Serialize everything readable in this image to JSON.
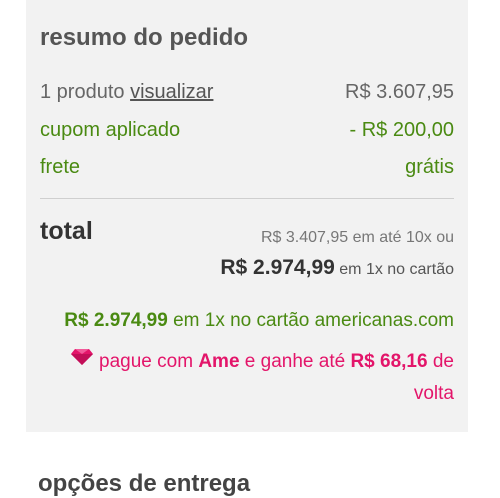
{
  "summary": {
    "title": "resumo do pedido",
    "products_prefix": "1 produto",
    "view_link": "visualizar",
    "products_price": "R$ 3.607,95",
    "coupon_label": "cupom aplicado",
    "coupon_value": "- R$ 200,00",
    "shipping_label": "frete",
    "shipping_value": "grátis"
  },
  "total": {
    "label": "total",
    "installments_text": "R$ 3.407,95 em até 10x ou",
    "cash_amount": "R$ 2.974,99",
    "cash_condition": "em 1x no cartão"
  },
  "promo": {
    "amount": "R$ 2.974,99",
    "text": "em 1x no cartão americanas.com"
  },
  "ame": {
    "text_before": "pague com",
    "brand": "Ame",
    "text_middle": "e ganhe até",
    "cashback": "R$ 68,16",
    "text_after": "de volta"
  },
  "next_section_title": "opções de entrega",
  "colors": {
    "green": "#4a8a12",
    "ame_pink": "#e3156a",
    "card_bg": "#f2f2f2"
  }
}
